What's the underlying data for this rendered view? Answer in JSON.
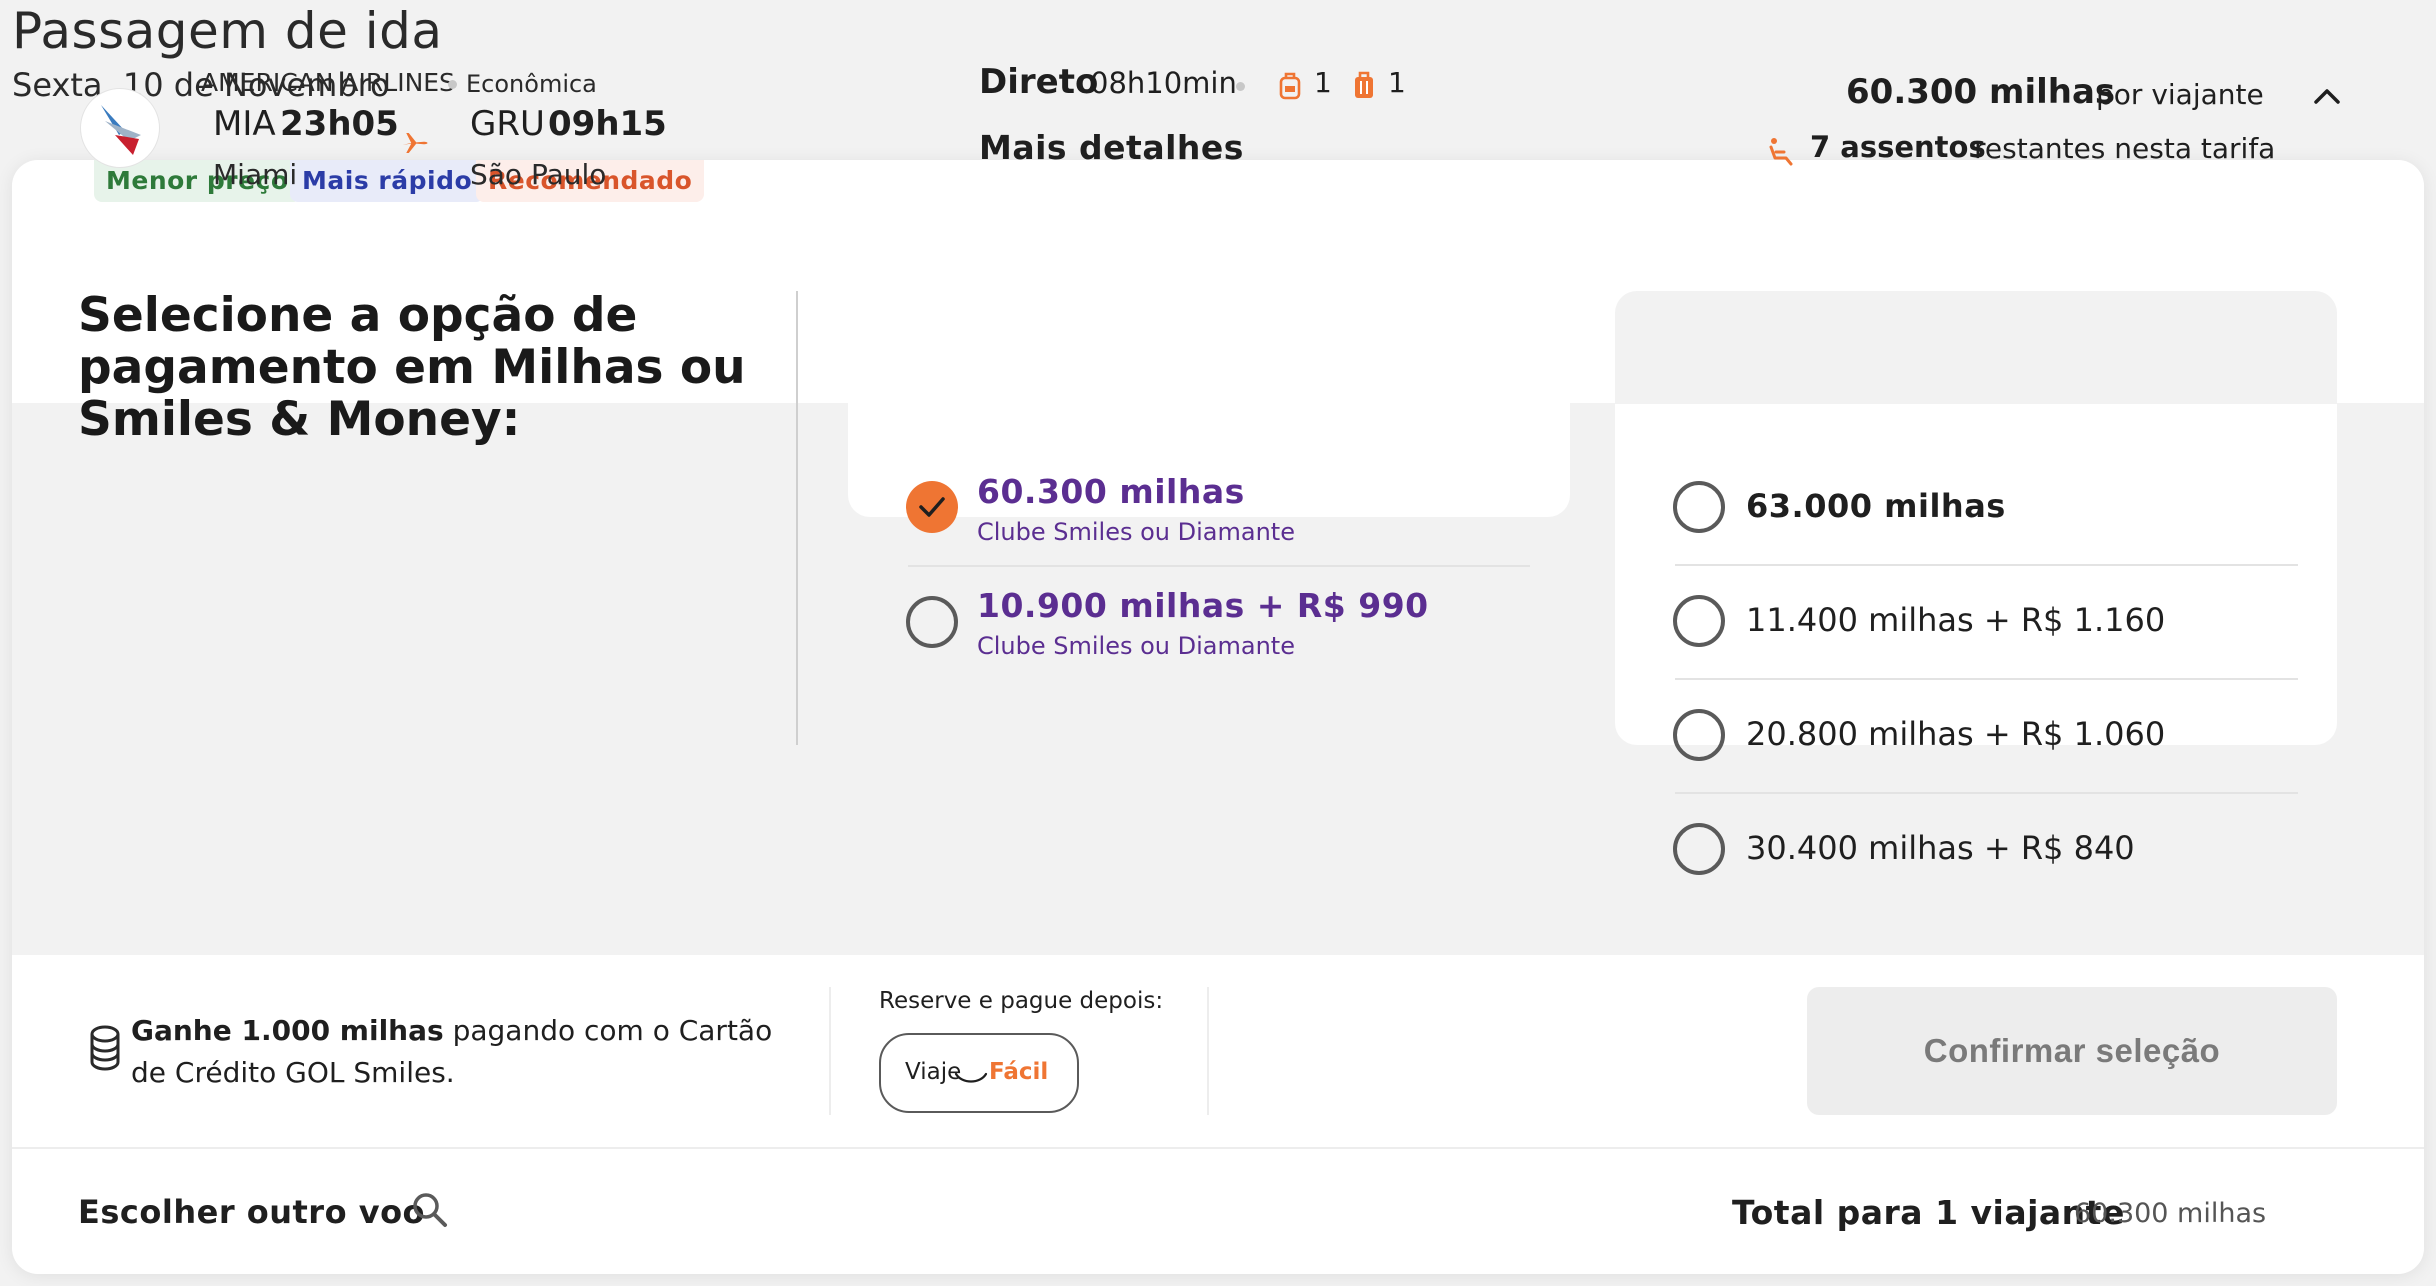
{
  "header": {
    "title": "Passagem de ida",
    "date": "Sexta, 10 de Novembro"
  },
  "tags": {
    "lowest_price": "Menor preço",
    "fastest": "Mais rápido",
    "recommended": "Recomendado"
  },
  "flight": {
    "airline": "AMERICAN AIRLINES",
    "cabin": "Econômica",
    "origin_code": "MIA",
    "origin_time": "23h05",
    "origin_city": "Miami",
    "dest_code": "GRU",
    "dest_time": "09h15",
    "dest_city": "São Paulo",
    "direct_label": "Direto",
    "duration": "08h10min",
    "carry_on_count": "1",
    "checked_bag_count": "1",
    "more_details": "Mais detalhes",
    "price_miles": "60.300 milhas",
    "price_per": "por viajante",
    "seats_bold": "7 assentos",
    "seats_rest": "restantes nesta tarifa"
  },
  "payment": {
    "heading": "Selecione a opção de pagamento em Milhas ou Smiles & Money:",
    "club_options": [
      {
        "title": "60.300 milhas",
        "subtitle": "Clube Smiles ou Diamante",
        "selected": true
      },
      {
        "title": "10.900 milhas + R$ 990",
        "subtitle": "Clube Smiles ou Diamante",
        "selected": false
      }
    ],
    "regular_options": [
      {
        "title": "63.000 milhas",
        "selected": false
      },
      {
        "title": "11.400 milhas + R$ 1.160",
        "selected": false
      },
      {
        "title": "20.800 milhas + R$ 1.060",
        "selected": false
      },
      {
        "title": "30.400 milhas + R$ 840",
        "selected": false
      }
    ]
  },
  "footer": {
    "earn_bold": "Ganhe 1.000 milhas",
    "earn_rest": "pagando com o Cartão de Crédito GOL Smiles.",
    "reserve_label": "Reserve e pague depois:",
    "viaje_a": "Viaje",
    "viaje_b": "Fácil",
    "confirm": "Confirmar seleção",
    "other_flight": "Escolher outro voo",
    "total_label": "Total para 1 viajante",
    "total_value": "60.300 milhas"
  },
  "colors": {
    "accent_orange": "#ef7533",
    "purple": "#5b2e91",
    "tag_green": "#2e7a3a",
    "tag_blue": "#2b3ca7",
    "tag_red": "#d9552b"
  }
}
